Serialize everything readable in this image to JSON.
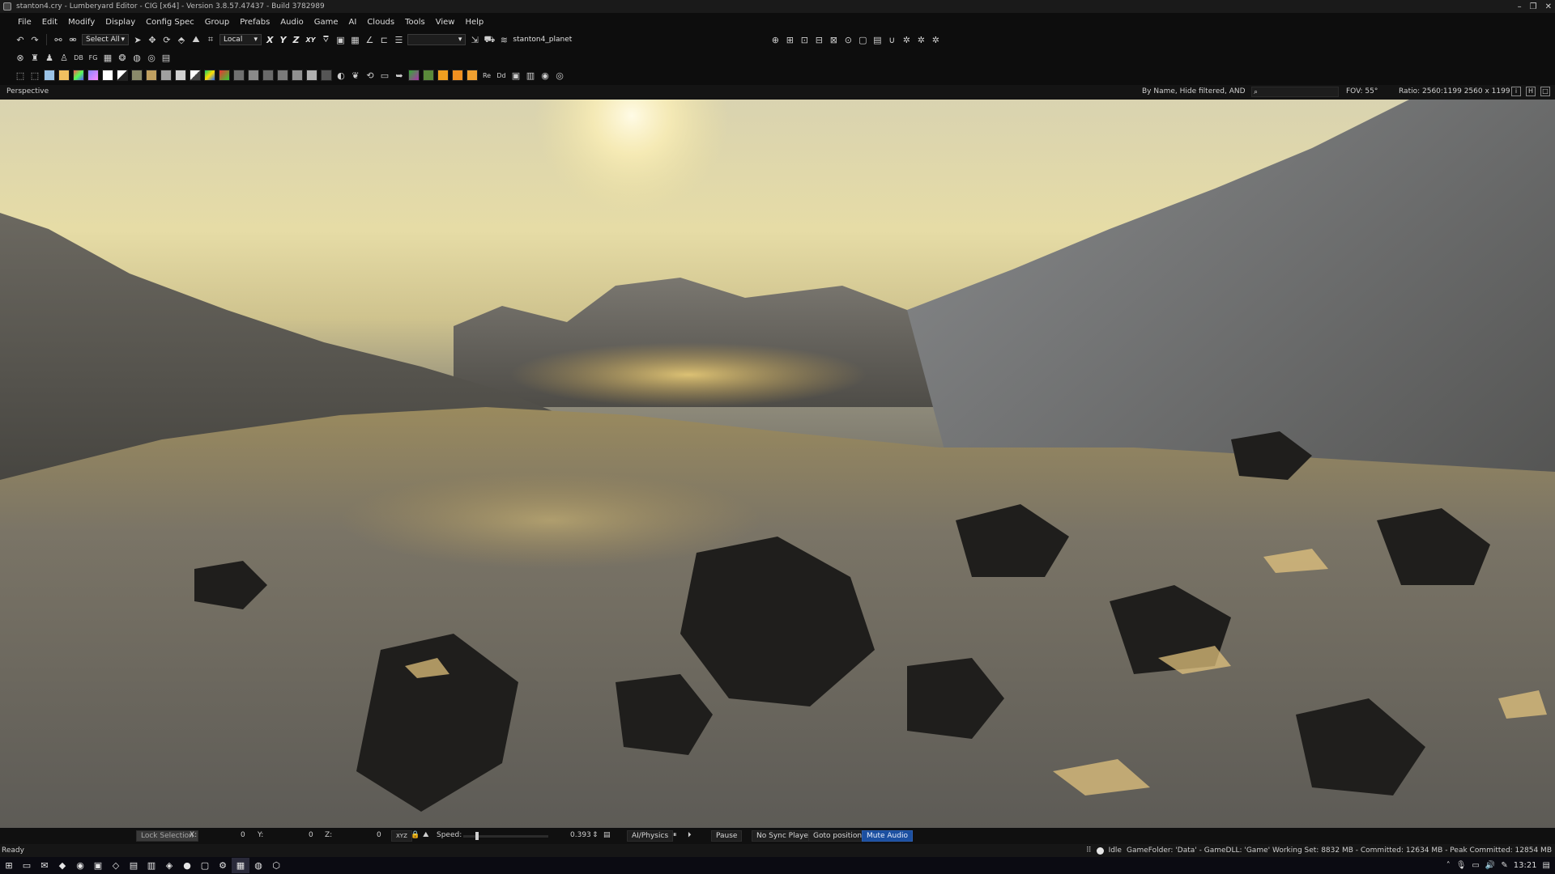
{
  "window": {
    "title": "stanton4.cry - Lumberyard Editor - CIG [x64] - Version 3.8.57.47437 - Build 3782989",
    "controls": [
      "–",
      "❐",
      "✕"
    ]
  },
  "menu": [
    "File",
    "Edit",
    "Modify",
    "Display",
    "Config Spec",
    "Group",
    "Prefabs",
    "Audio",
    "Game",
    "AI",
    "Clouds",
    "Tools",
    "View",
    "Help"
  ],
  "toolbar": {
    "select_label": "Select All",
    "coord_label": "Local",
    "axes": [
      "X",
      "Y",
      "Z",
      "XY"
    ],
    "layer_label": "stanton4_planet"
  },
  "viewport_header": {
    "view_name": "Perspective",
    "filter_text": "By Name, Hide filtered, AND",
    "fov": "FOV:   55°",
    "ratio": "Ratio: 2560:1199   2560 x 1199"
  },
  "controls": {
    "lock_selection": "Lock Selection",
    "x_label": "X:",
    "x_value": "0",
    "y_label": "Y:",
    "y_value": "0",
    "z_label": "Z:",
    "z_value": "0",
    "xyz_label": "XYZ",
    "speed_label": "Speed:",
    "speed_value": "0.393",
    "speed_level": 0.14,
    "ai_physics": "AI/Physics",
    "pause": "Pause",
    "no_sync": "No Sync Player",
    "goto": "Goto position",
    "mute": "Mute Audio"
  },
  "status": {
    "ready": "Ready",
    "idle": "Idle",
    "info": "GameFolder: 'Data' - GameDLL: 'Game'   Working Set: 8832 MB - Committed: 12634 MB - Peak Committed: 12854 MB"
  },
  "taskbar": {
    "time": "13:21"
  }
}
